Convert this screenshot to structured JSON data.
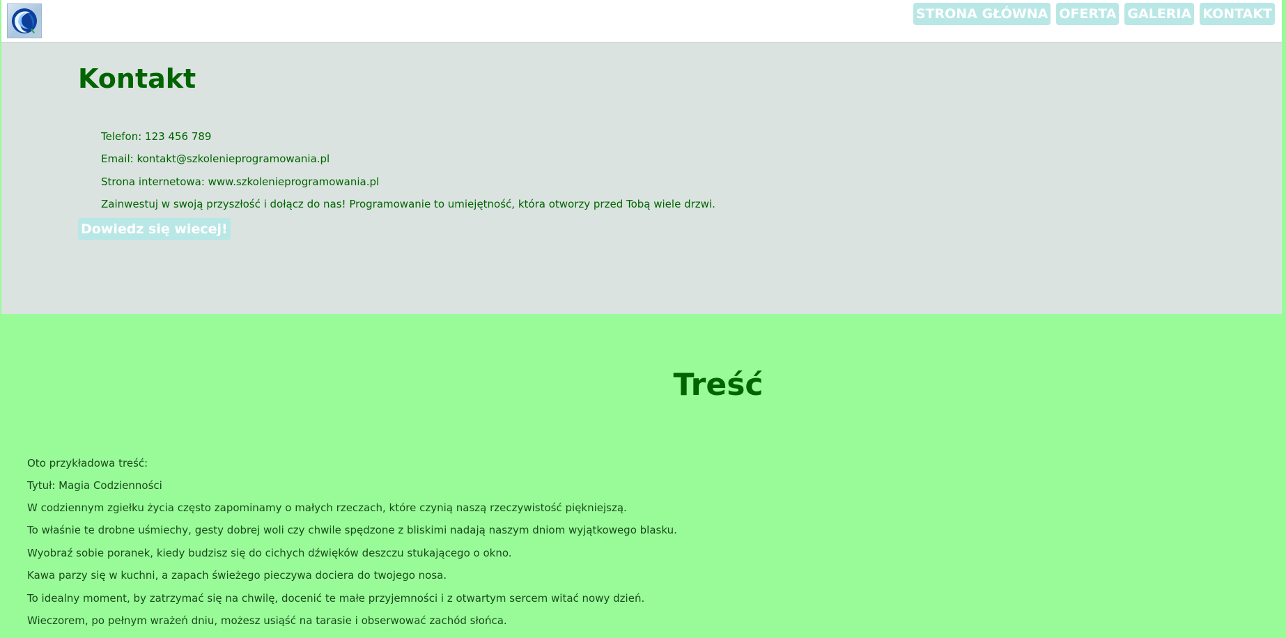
{
  "header": {
    "logo_icon": "globe-logo-icon",
    "nav": [
      {
        "label": "STRONA GŁÓWNA"
      },
      {
        "label": "OFERTA"
      },
      {
        "label": "GALERIA"
      },
      {
        "label": "KONTAKT"
      }
    ]
  },
  "contact": {
    "title": "Kontakt",
    "lines": [
      "Telefon: 123 456 789",
      "Email: kontakt@szkolenieprogramowania.pl",
      "Strona internetowa: www.szkolenieprogramowania.pl",
      "Zainwestuj w swoją przyszłość i dołącz do nas! Programowanie to umiejętność, która otworzy przed Tobą wiele drzwi."
    ],
    "cta_label": "Dowiedz się wiecej!"
  },
  "content": {
    "title": "Treść",
    "paragraphs": [
      "Oto przykładowa treść:",
      "Tytuł: Magia Codzienności",
      "W codziennym zgiełku życia często zapominamy o małych rzeczach, które czynią naszą rzeczywistość piękniejszą.",
      "To właśnie te drobne uśmiechy, gesty dobrej woli czy chwile spędzone z bliskimi nadają naszym dniom wyjątkowego blasku.",
      "Wyobraź sobie poranek, kiedy budzisz się do cichych dźwięków deszczu stukającego o okno.",
      "Kawa parzy się w kuchni, a zapach świeżego pieczywa dociera do twojego nosa.",
      "To idealny moment, by zatrzymać się na chwilę, docenić te małe przyjemności i z otwartym sercem witać nowy dzień.",
      "Wieczorem, po pełnym wrażeń dniu, możesz usiąść na tarasie i obserwować zachód słońca."
    ]
  },
  "colors": {
    "page_bg": "#98fb98",
    "contact_bg": "#dae3df",
    "heading": "#006400",
    "button_bg": "#b8e7e6",
    "button_text": "#ffffff"
  }
}
